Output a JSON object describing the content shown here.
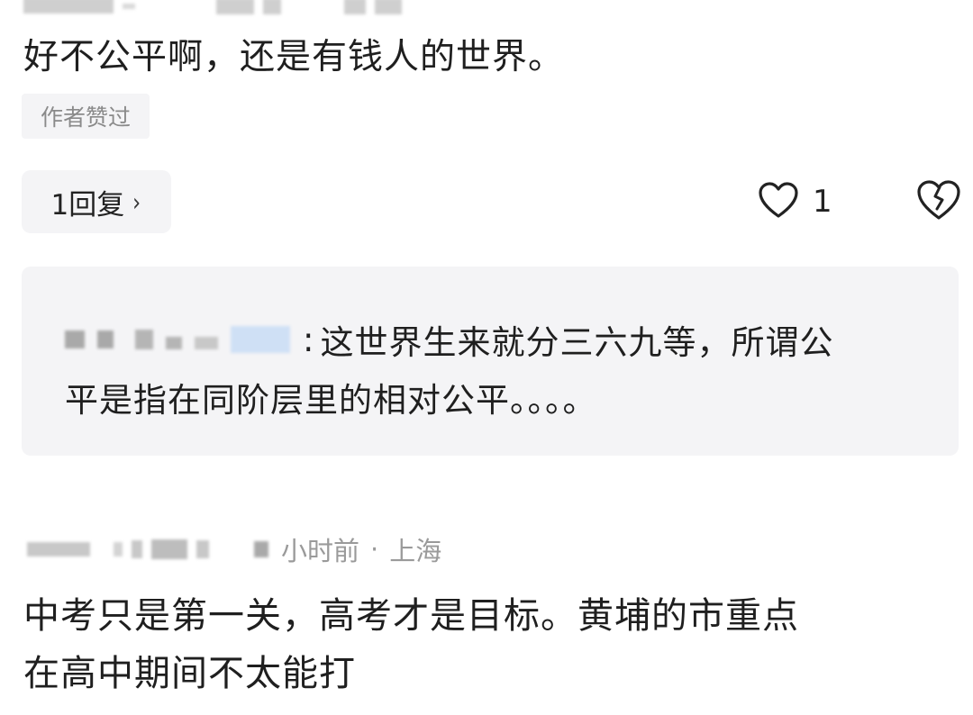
{
  "comment1": {
    "text": "好不公平啊，还是有钱人的世界。",
    "badge": "作者赞过",
    "reply_button_label": "1回复",
    "reply_chevron": "›",
    "like_count": "1",
    "like_icon": "heart-outline-icon",
    "dislike_icon": "broken-heart-icon"
  },
  "reply": {
    "separator": ":",
    "line1": "这世界生来就分三六九等，所谓公",
    "line2": "平是指在同阶层里的相对公平。。。。"
  },
  "comment2": {
    "meta_time": "小时前",
    "meta_dot": "·",
    "meta_location": "上海",
    "line1": "中考只是第一关，高考才是目标。黄埔的市重点",
    "line2": "在高中期间不太能打"
  },
  "colors": {
    "text": "#1f1f1f",
    "muted": "#9a9a9a",
    "panel": "#f4f4f6"
  }
}
